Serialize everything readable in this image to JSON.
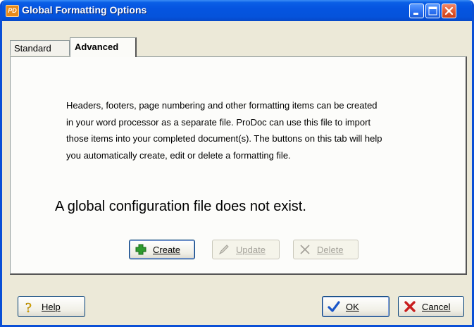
{
  "window": {
    "title": "Global Formatting Options",
    "app_icon_text": "PD",
    "controls": [
      "minimize-icon",
      "maximize-icon",
      "close-icon"
    ]
  },
  "tabs": [
    {
      "label": "Standard",
      "active": false
    },
    {
      "label": "Advanced",
      "active": true
    }
  ],
  "description_lines": [
    "Headers, footers, page numbering and other formatting items can be created",
    "in your word processor as a separate file.  ProDoc can use this file to import",
    "those items into your completed document(s).  The buttons on this tab will help",
    "you automatically create, edit or delete a formatting file."
  ],
  "status_message": "A global configuration file does not exist.",
  "actions": {
    "create": {
      "label": "Create",
      "enabled": true,
      "icon": "plus-icon",
      "color": "#2e9a2e"
    },
    "update": {
      "label": "Update",
      "enabled": false,
      "icon": "pencil-icon"
    },
    "delete": {
      "label": "Delete",
      "enabled": false,
      "icon": "x-icon"
    }
  },
  "footer": {
    "help": {
      "label": "Help",
      "icon": "question-icon",
      "color": "#e8b400"
    },
    "ok": {
      "label": "OK",
      "icon": "checkmark-icon",
      "color": "#1a56c8"
    },
    "cancel": {
      "label": "Cancel",
      "icon": "red-x-icon",
      "color": "#c81e1e"
    }
  },
  "colors": {
    "titlebar": "#0554e0",
    "dialog_bg": "#ece9d8",
    "panel_bg": "#fcfcfa"
  }
}
